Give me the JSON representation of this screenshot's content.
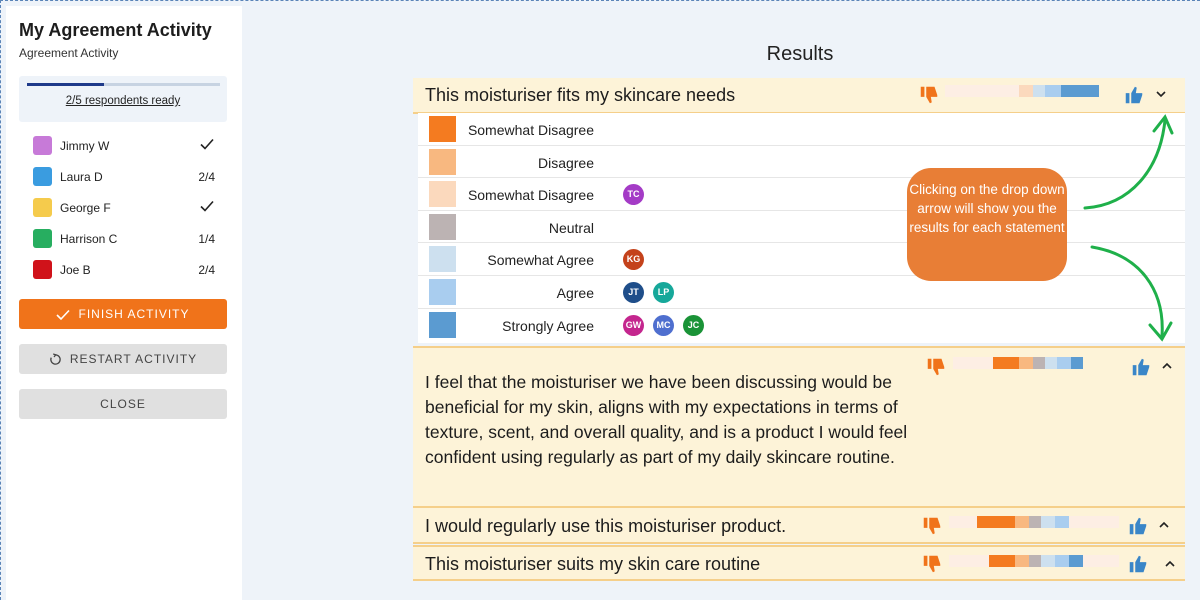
{
  "sidebar": {
    "title": "My Agreement Activity",
    "subtitle": "Agreement Activity",
    "progress": {
      "fraction": 0.4,
      "label": "2/5 respondents ready"
    },
    "participants": [
      {
        "name": "Jimmy W",
        "color": "#c77ad8",
        "status": "",
        "done": true
      },
      {
        "name": "Laura D",
        "color": "#3a9ce0",
        "status": "2/4",
        "done": false
      },
      {
        "name": "George F",
        "color": "#f5cb4c",
        "status": "",
        "done": true
      },
      {
        "name": "Harrison C",
        "color": "#27ae60",
        "status": "1/4",
        "done": false
      },
      {
        "name": "Joe B",
        "color": "#d0121a",
        "status": "2/4",
        "done": false
      }
    ],
    "finish_label": "FINISH ACTIVITY",
    "restart_label": "RESTART ACTIVITY",
    "close_label": "CLOSE"
  },
  "main": {
    "title": "Results",
    "statements": [
      {
        "text": "This moisturiser fits my skincare needs",
        "expanded": true
      },
      {
        "text": "I feel that the moisturiser we have been discussing would be beneficial for my skin, aligns with my expectations in terms of texture, scent, and overall quality, and is a product I would feel confident using regularly as part of my daily skincare routine.",
        "expanded": false
      },
      {
        "text": "I would regularly use this moisturiser product.",
        "expanded": false
      },
      {
        "text": "This moisturiser suits my skin care routine",
        "expanded": false
      }
    ],
    "breakdown": [
      {
        "label": "Somewhat Disagree",
        "color": "#f47b20",
        "avatars": []
      },
      {
        "label": "Disagree",
        "color": "#f8b880",
        "avatars": []
      },
      {
        "label": "Somewhat Disagree",
        "color": "#fbd9bd",
        "avatars": [
          {
            "initials": "TC",
            "color": "#a43bc6"
          }
        ]
      },
      {
        "label": "Neutral",
        "color": "#bcb3b3",
        "avatars": []
      },
      {
        "label": "Somewhat Agree",
        "color": "#cde0ef",
        "avatars": [
          {
            "initials": "KG",
            "color": "#c4421b"
          }
        ]
      },
      {
        "label": "Agree",
        "color": "#a9cdef",
        "avatars": [
          {
            "initials": "JT",
            "color": "#1f4e8a"
          },
          {
            "initials": "LP",
            "color": "#16a89a"
          }
        ]
      },
      {
        "label": "Strongly Agree",
        "color": "#5b9bd1",
        "avatars": [
          {
            "initials": "GW",
            "color": "#c4268e"
          },
          {
            "initials": "MC",
            "color": "#4f6fcf"
          },
          {
            "initials": "JC",
            "color": "#1a9337"
          }
        ]
      }
    ],
    "callout": "Clicking on the drop down arrow will show you the results for each statement"
  },
  "colors": {
    "accent": "#f0731a",
    "thumb_down": "#f0731a",
    "thumb_up": "#3a86c8",
    "callout": "#e87e36",
    "arrow": "#1fb04a"
  }
}
